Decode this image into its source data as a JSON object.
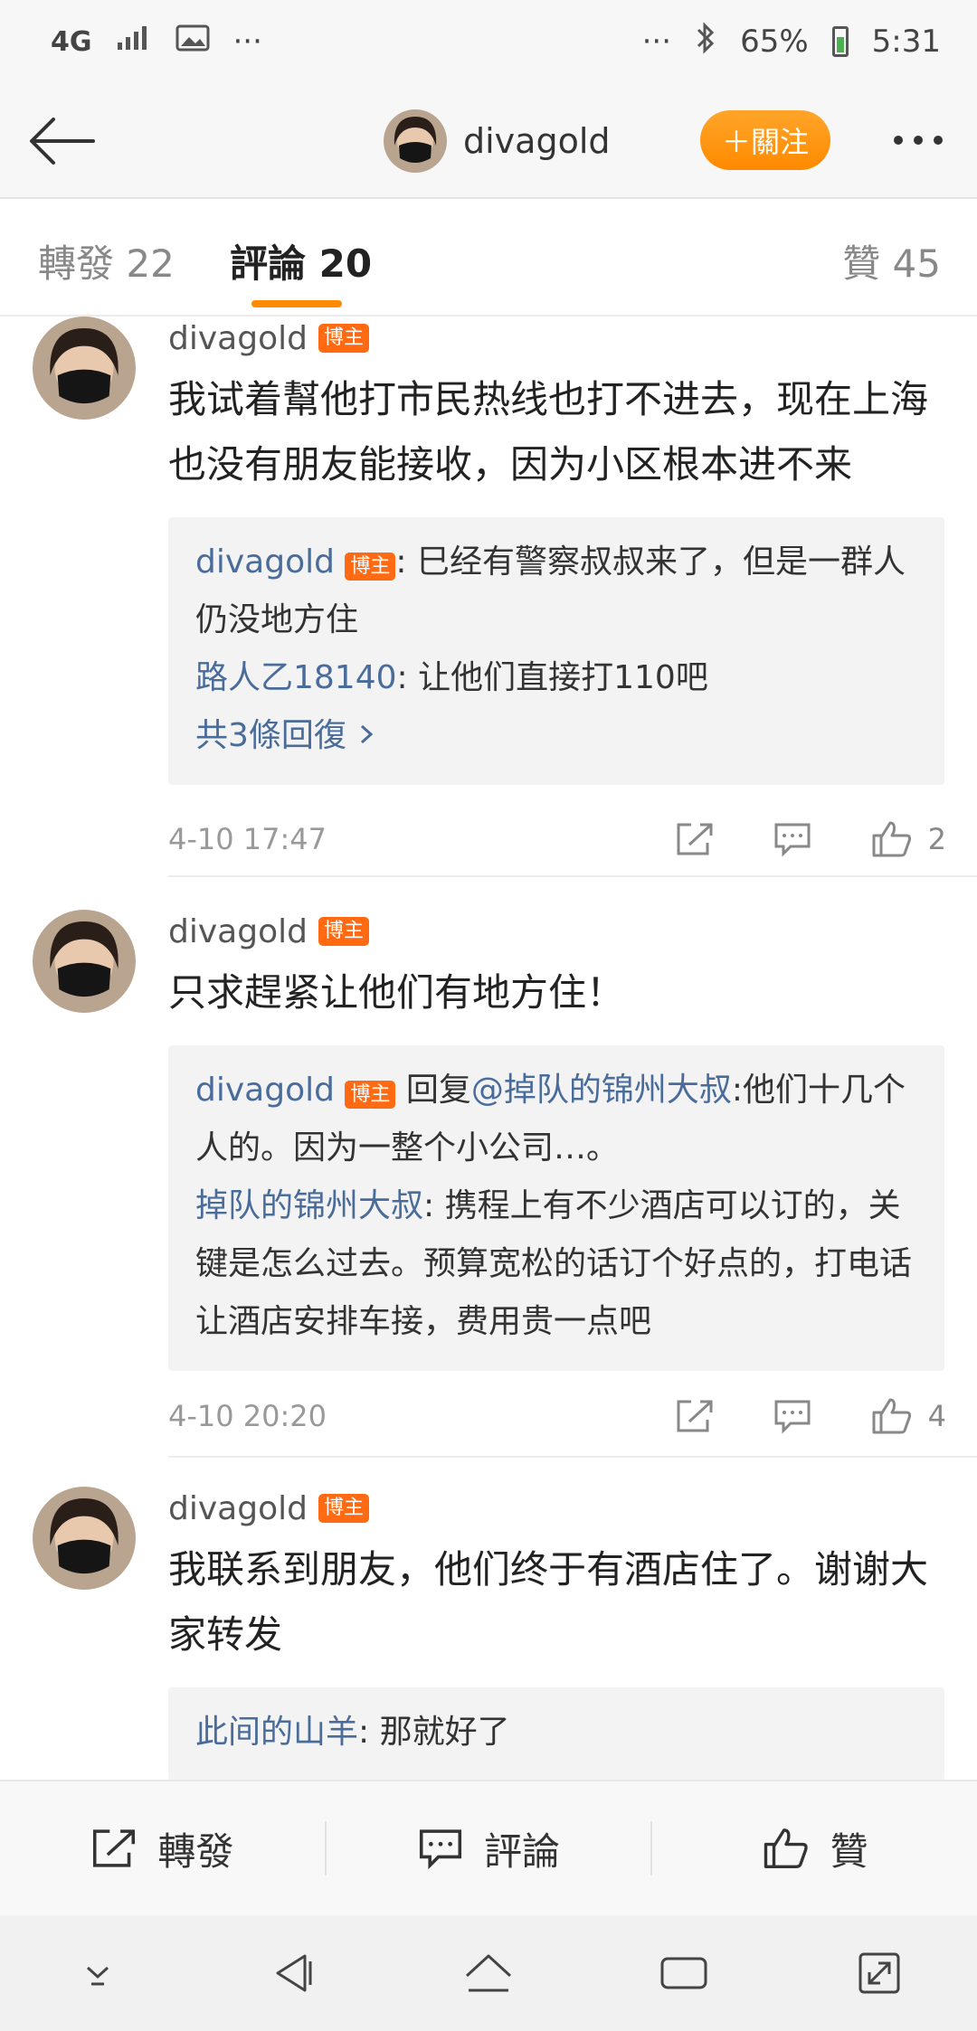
{
  "status_bar": {
    "network": "4G",
    "more": "···",
    "right_more": "···",
    "battery_percent": "65%",
    "time": "5:31"
  },
  "header": {
    "username": "divagold",
    "follow_label": "＋關注"
  },
  "tabs": {
    "repost": "轉發 22",
    "comment": "評論 20",
    "like": "贊 45"
  },
  "comments": [
    {
      "name": "divagold",
      "badge": "博主",
      "text": "我试着幫他打市民热线也打不进去，现在上海也没有朋友能接收，因为小区根本进不来",
      "replies": [
        {
          "user": "divagold",
          "badge": "博主",
          "sep": ": ",
          "text": "巳经有警察叔叔来了，但是一群人仍没地方住"
        },
        {
          "user": "路人乙18140",
          "sep": ": ",
          "text": "让他们直接打110吧"
        }
      ],
      "more_replies": "共3條回復",
      "time": "4-10 17:47",
      "likes": "2"
    },
    {
      "name": "divagold",
      "badge": "博主",
      "text": "只求趕紧让他们有地方住！",
      "replies": [
        {
          "user": "divagold",
          "badge": "博主",
          "prefix": " 回复",
          "mention": "@掉队的锦州大叔",
          "sep": ":",
          "text": "他们十几个人的。因为一整个小公司…。"
        },
        {
          "user": "掉队的锦州大叔",
          "sep": ": ",
          "text": "携程上有不少酒店可以订的，关键是怎么过去。预算宽松的话订个好点的，打电话让酒店安排车接，费用贵一点吧"
        }
      ],
      "time": "4-10 20:20",
      "likes": "4"
    },
    {
      "name": "divagold",
      "badge": "博主",
      "text": "我联系到朋友，他们终于有酒店住了。谢谢大家转发",
      "replies": [
        {
          "user": "此间的山羊",
          "sep": ": ",
          "text": "那就好了"
        }
      ]
    }
  ],
  "bottom_bar": {
    "repost": "轉發",
    "comment": "評論",
    "like": "贊"
  },
  "colors": {
    "accent": "#ff8a00",
    "link": "#4a6c9a",
    "badge": "#ff6a13"
  }
}
